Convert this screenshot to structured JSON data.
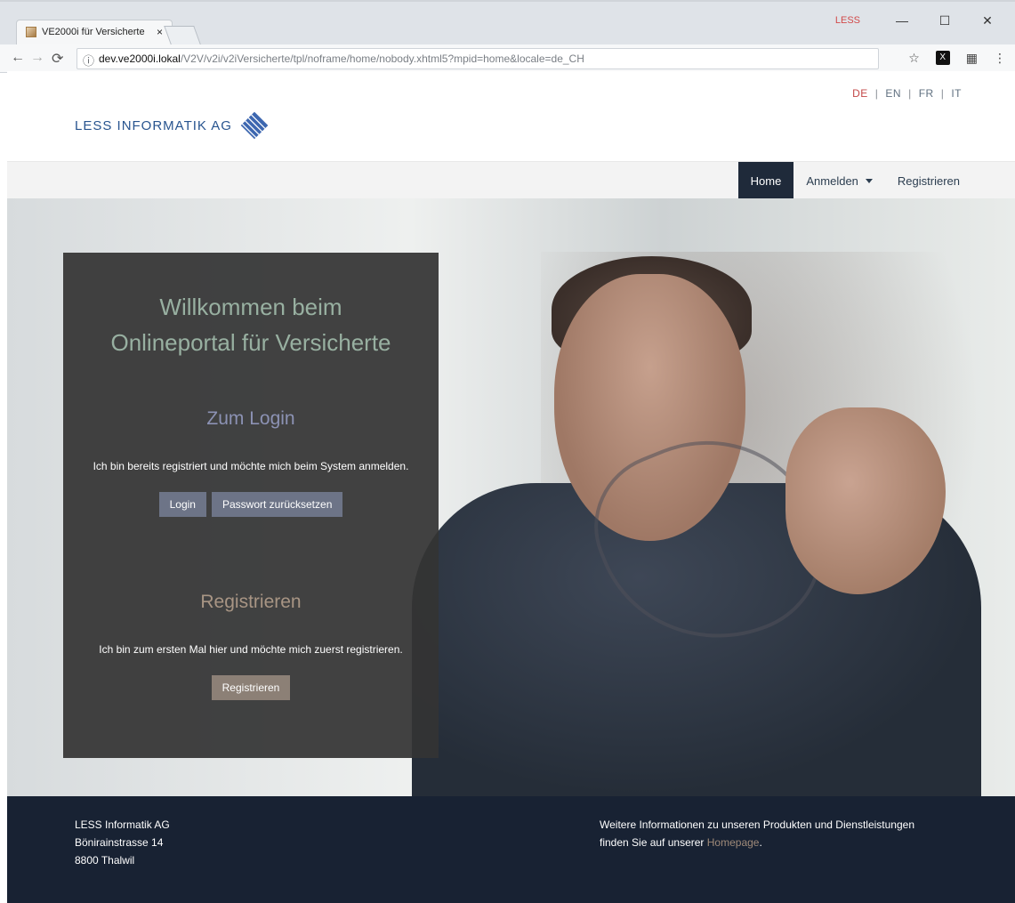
{
  "browser": {
    "tab_title": "VE2000i für Versicherte",
    "tab_close": "×",
    "url_host": "dev.ve2000i.lokal",
    "url_path": "/V2V/v2i/v2iVersicherte/tpl/noframe/home/nobody.xhtml5?mpid=home&locale=de_CH",
    "less_badge": "LESS",
    "ext_label": "X"
  },
  "page": {
    "languages": [
      "DE",
      "EN",
      "FR",
      "IT"
    ],
    "logo_text": "LESS INFORMATIK AG",
    "nav": {
      "home": "Home",
      "anmelden": "Anmelden",
      "registrieren": "Registrieren"
    },
    "panel": {
      "welcome_line1": "Willkommen beim",
      "welcome_line2": "Onlineportal für Versicherte",
      "login_title": "Zum Login",
      "login_text": "Ich bin bereits registriert und möchte mich beim System anmelden.",
      "login_button": "Login",
      "reset_button": "Passwort zurücksetzen",
      "register_title": "Registrieren",
      "register_text": "Ich bin zum ersten Mal hier und möchte mich zuerst registrieren.",
      "register_button": "Registrieren"
    },
    "footer": {
      "company": "LESS Informatik AG",
      "street": "Bönirainstrasse 14",
      "city": "8800 Thalwil",
      "info_text_1": "Weitere Informationen zu unseren Produkten und Dienstleistungen",
      "info_text_2": "finden Sie auf unserer",
      "info_link": "Homepage",
      "info_end": "."
    }
  }
}
